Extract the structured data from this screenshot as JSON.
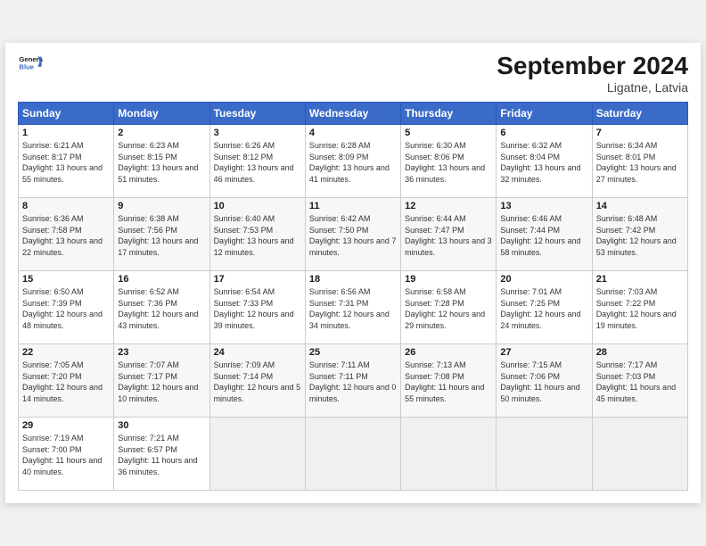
{
  "header": {
    "logo_line1": "General",
    "logo_line2": "Blue",
    "title": "September 2024",
    "subtitle": "Ligatne, Latvia"
  },
  "weekdays": [
    "Sunday",
    "Monday",
    "Tuesday",
    "Wednesday",
    "Thursday",
    "Friday",
    "Saturday"
  ],
  "weeks": [
    [
      {
        "day": "1",
        "sunrise": "Sunrise: 6:21 AM",
        "sunset": "Sunset: 8:17 PM",
        "daylight": "Daylight: 13 hours and 55 minutes."
      },
      {
        "day": "2",
        "sunrise": "Sunrise: 6:23 AM",
        "sunset": "Sunset: 8:15 PM",
        "daylight": "Daylight: 13 hours and 51 minutes."
      },
      {
        "day": "3",
        "sunrise": "Sunrise: 6:26 AM",
        "sunset": "Sunset: 8:12 PM",
        "daylight": "Daylight: 13 hours and 46 minutes."
      },
      {
        "day": "4",
        "sunrise": "Sunrise: 6:28 AM",
        "sunset": "Sunset: 8:09 PM",
        "daylight": "Daylight: 13 hours and 41 minutes."
      },
      {
        "day": "5",
        "sunrise": "Sunrise: 6:30 AM",
        "sunset": "Sunset: 8:06 PM",
        "daylight": "Daylight: 13 hours and 36 minutes."
      },
      {
        "day": "6",
        "sunrise": "Sunrise: 6:32 AM",
        "sunset": "Sunset: 8:04 PM",
        "daylight": "Daylight: 13 hours and 32 minutes."
      },
      {
        "day": "7",
        "sunrise": "Sunrise: 6:34 AM",
        "sunset": "Sunset: 8:01 PM",
        "daylight": "Daylight: 13 hours and 27 minutes."
      }
    ],
    [
      {
        "day": "8",
        "sunrise": "Sunrise: 6:36 AM",
        "sunset": "Sunset: 7:58 PM",
        "daylight": "Daylight: 13 hours and 22 minutes."
      },
      {
        "day": "9",
        "sunrise": "Sunrise: 6:38 AM",
        "sunset": "Sunset: 7:56 PM",
        "daylight": "Daylight: 13 hours and 17 minutes."
      },
      {
        "day": "10",
        "sunrise": "Sunrise: 6:40 AM",
        "sunset": "Sunset: 7:53 PM",
        "daylight": "Daylight: 13 hours and 12 minutes."
      },
      {
        "day": "11",
        "sunrise": "Sunrise: 6:42 AM",
        "sunset": "Sunset: 7:50 PM",
        "daylight": "Daylight: 13 hours and 7 minutes."
      },
      {
        "day": "12",
        "sunrise": "Sunrise: 6:44 AM",
        "sunset": "Sunset: 7:47 PM",
        "daylight": "Daylight: 13 hours and 3 minutes."
      },
      {
        "day": "13",
        "sunrise": "Sunrise: 6:46 AM",
        "sunset": "Sunset: 7:44 PM",
        "daylight": "Daylight: 12 hours and 58 minutes."
      },
      {
        "day": "14",
        "sunrise": "Sunrise: 6:48 AM",
        "sunset": "Sunset: 7:42 PM",
        "daylight": "Daylight: 12 hours and 53 minutes."
      }
    ],
    [
      {
        "day": "15",
        "sunrise": "Sunrise: 6:50 AM",
        "sunset": "Sunset: 7:39 PM",
        "daylight": "Daylight: 12 hours and 48 minutes."
      },
      {
        "day": "16",
        "sunrise": "Sunrise: 6:52 AM",
        "sunset": "Sunset: 7:36 PM",
        "daylight": "Daylight: 12 hours and 43 minutes."
      },
      {
        "day": "17",
        "sunrise": "Sunrise: 6:54 AM",
        "sunset": "Sunset: 7:33 PM",
        "daylight": "Daylight: 12 hours and 39 minutes."
      },
      {
        "day": "18",
        "sunrise": "Sunrise: 6:56 AM",
        "sunset": "Sunset: 7:31 PM",
        "daylight": "Daylight: 12 hours and 34 minutes."
      },
      {
        "day": "19",
        "sunrise": "Sunrise: 6:58 AM",
        "sunset": "Sunset: 7:28 PM",
        "daylight": "Daylight: 12 hours and 29 minutes."
      },
      {
        "day": "20",
        "sunrise": "Sunrise: 7:01 AM",
        "sunset": "Sunset: 7:25 PM",
        "daylight": "Daylight: 12 hours and 24 minutes."
      },
      {
        "day": "21",
        "sunrise": "Sunrise: 7:03 AM",
        "sunset": "Sunset: 7:22 PM",
        "daylight": "Daylight: 12 hours and 19 minutes."
      }
    ],
    [
      {
        "day": "22",
        "sunrise": "Sunrise: 7:05 AM",
        "sunset": "Sunset: 7:20 PM",
        "daylight": "Daylight: 12 hours and 14 minutes."
      },
      {
        "day": "23",
        "sunrise": "Sunrise: 7:07 AM",
        "sunset": "Sunset: 7:17 PM",
        "daylight": "Daylight: 12 hours and 10 minutes."
      },
      {
        "day": "24",
        "sunrise": "Sunrise: 7:09 AM",
        "sunset": "Sunset: 7:14 PM",
        "daylight": "Daylight: 12 hours and 5 minutes."
      },
      {
        "day": "25",
        "sunrise": "Sunrise: 7:11 AM",
        "sunset": "Sunset: 7:11 PM",
        "daylight": "Daylight: 12 hours and 0 minutes."
      },
      {
        "day": "26",
        "sunrise": "Sunrise: 7:13 AM",
        "sunset": "Sunset: 7:08 PM",
        "daylight": "Daylight: 11 hours and 55 minutes."
      },
      {
        "day": "27",
        "sunrise": "Sunrise: 7:15 AM",
        "sunset": "Sunset: 7:06 PM",
        "daylight": "Daylight: 11 hours and 50 minutes."
      },
      {
        "day": "28",
        "sunrise": "Sunrise: 7:17 AM",
        "sunset": "Sunset: 7:03 PM",
        "daylight": "Daylight: 11 hours and 45 minutes."
      }
    ],
    [
      {
        "day": "29",
        "sunrise": "Sunrise: 7:19 AM",
        "sunset": "Sunset: 7:00 PM",
        "daylight": "Daylight: 11 hours and 40 minutes."
      },
      {
        "day": "30",
        "sunrise": "Sunrise: 7:21 AM",
        "sunset": "Sunset: 6:57 PM",
        "daylight": "Daylight: 11 hours and 36 minutes."
      },
      null,
      null,
      null,
      null,
      null
    ]
  ]
}
